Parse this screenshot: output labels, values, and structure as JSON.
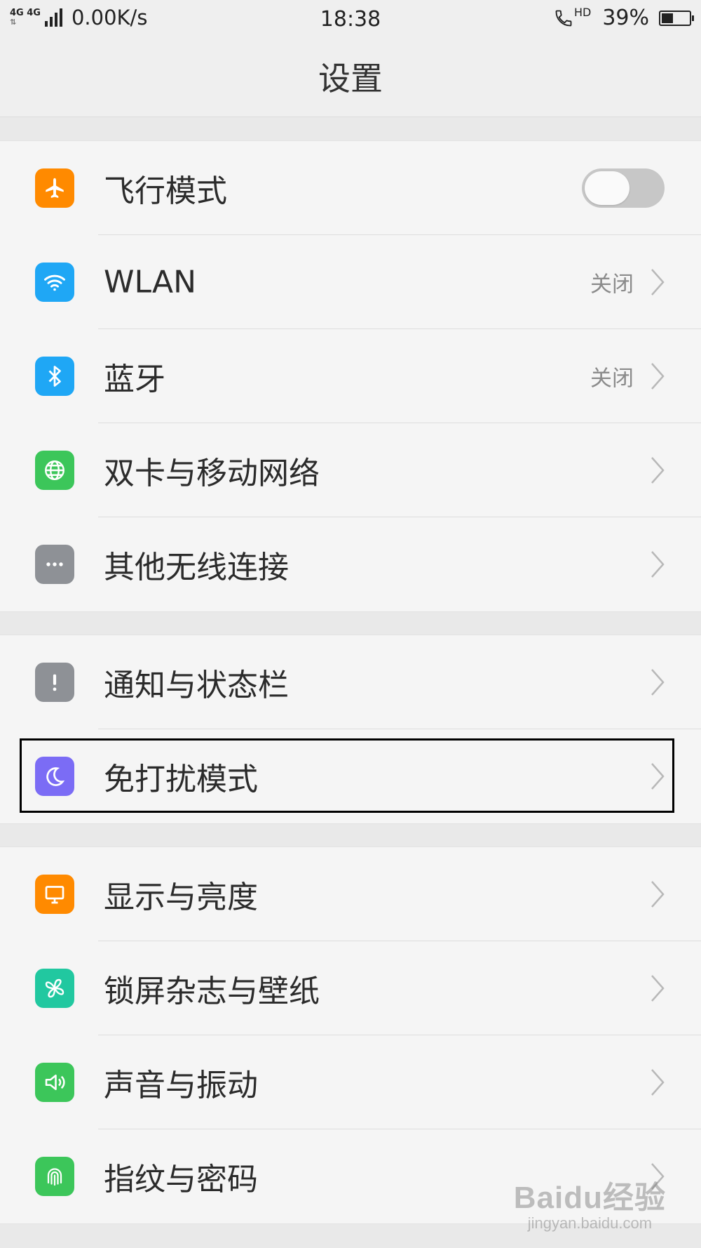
{
  "status_bar": {
    "network_top": "4G 4G",
    "network_arrows": "⇅",
    "speed": "0.00K/s",
    "time": "18:38",
    "hd": "HD",
    "battery_percent": "39%",
    "battery_level": 0.39
  },
  "header": {
    "title": "设置"
  },
  "groups": [
    {
      "items": [
        {
          "label": "飞行模式",
          "icon": "airplane-icon",
          "color": "#ff8a00",
          "toggle": true,
          "toggle_on": false
        },
        {
          "label": "WLAN",
          "icon": "wifi-icon",
          "color": "#1fa7f5",
          "status": "关闭"
        },
        {
          "label": "蓝牙",
          "icon": "bluetooth-icon",
          "color": "#1fa7f5",
          "status": "关闭"
        },
        {
          "label": "双卡与移动网络",
          "icon": "globe-icon",
          "color": "#3cc65a"
        },
        {
          "label": "其他无线连接",
          "icon": "more-dots-icon",
          "color": "#8e9196"
        }
      ]
    },
    {
      "items": [
        {
          "label": "通知与状态栏",
          "icon": "exclamation-icon",
          "color": "#8e9196"
        },
        {
          "label": "免打扰模式",
          "icon": "moon-icon",
          "color": "#7b6cf5"
        }
      ]
    },
    {
      "items": [
        {
          "label": "显示与亮度",
          "icon": "monitor-icon",
          "color": "#ff8a00"
        },
        {
          "label": "锁屏杂志与壁纸",
          "icon": "pinwheel-icon",
          "color": "#21c8a0"
        },
        {
          "label": "声音与振动",
          "icon": "speaker-icon",
          "color": "#3cc65a"
        },
        {
          "label": "指纹与密码",
          "icon": "fingerprint-icon",
          "color": "#3cc65a"
        }
      ]
    }
  ],
  "watermark": {
    "logo": "Baidu经验",
    "url": "jingyan.baidu.com"
  }
}
